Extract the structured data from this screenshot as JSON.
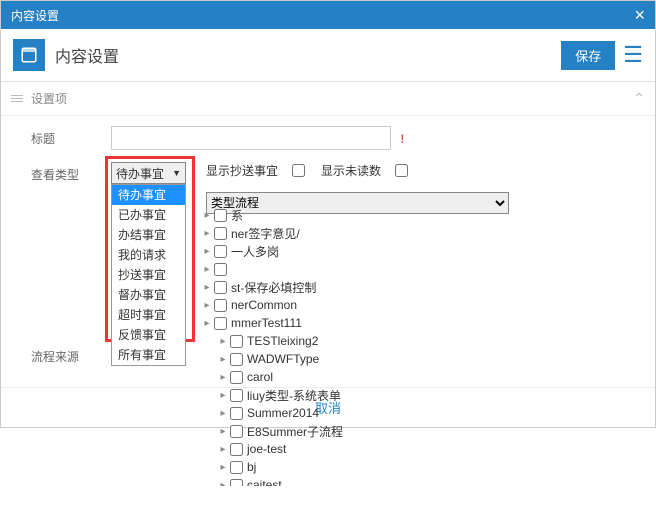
{
  "header": {
    "title": "内容设置"
  },
  "page": {
    "title": "内容设置"
  },
  "buttons": {
    "save": "保存",
    "cancel": "取消"
  },
  "section": {
    "title": "设置项"
  },
  "form": {
    "title_label": "标题",
    "title_value": "",
    "view_type_label": "查看类型",
    "view_type_value": "待办事宜",
    "show_copy_label": "显示抄送事宜",
    "show_unread_label": "显示未读数",
    "flow_type_label": "类型流程",
    "flow_source_label": "流程来源"
  },
  "dropdown_options": [
    "待办事宜",
    "已办事宜",
    "办结事宜",
    "我的请求",
    "抄送事宜",
    "督办事宜",
    "超时事宜",
    "反馈事宜",
    "所有事宜"
  ],
  "tree": [
    {
      "level": 0,
      "label": "系"
    },
    {
      "level": 0,
      "label": "ner签字意见/"
    },
    {
      "level": 0,
      "label": "一人多岗"
    },
    {
      "level": 0,
      "label": ""
    },
    {
      "level": 0,
      "label": "st-保存必填控制"
    },
    {
      "level": 0,
      "label": "nerCommon"
    },
    {
      "level": 0,
      "label": "mmerTest111"
    },
    {
      "level": 1,
      "label": "TESTleixing2"
    },
    {
      "level": 1,
      "label": "WADWFType"
    },
    {
      "level": 1,
      "label": "carol"
    },
    {
      "level": 1,
      "label": "liuy类型-系统表单"
    },
    {
      "level": 1,
      "label": "Summer2014"
    },
    {
      "level": 1,
      "label": "E8Summer子流程"
    },
    {
      "level": 1,
      "label": "joe-test"
    },
    {
      "level": 1,
      "label": "bj"
    },
    {
      "level": 1,
      "label": "caitest"
    }
  ]
}
